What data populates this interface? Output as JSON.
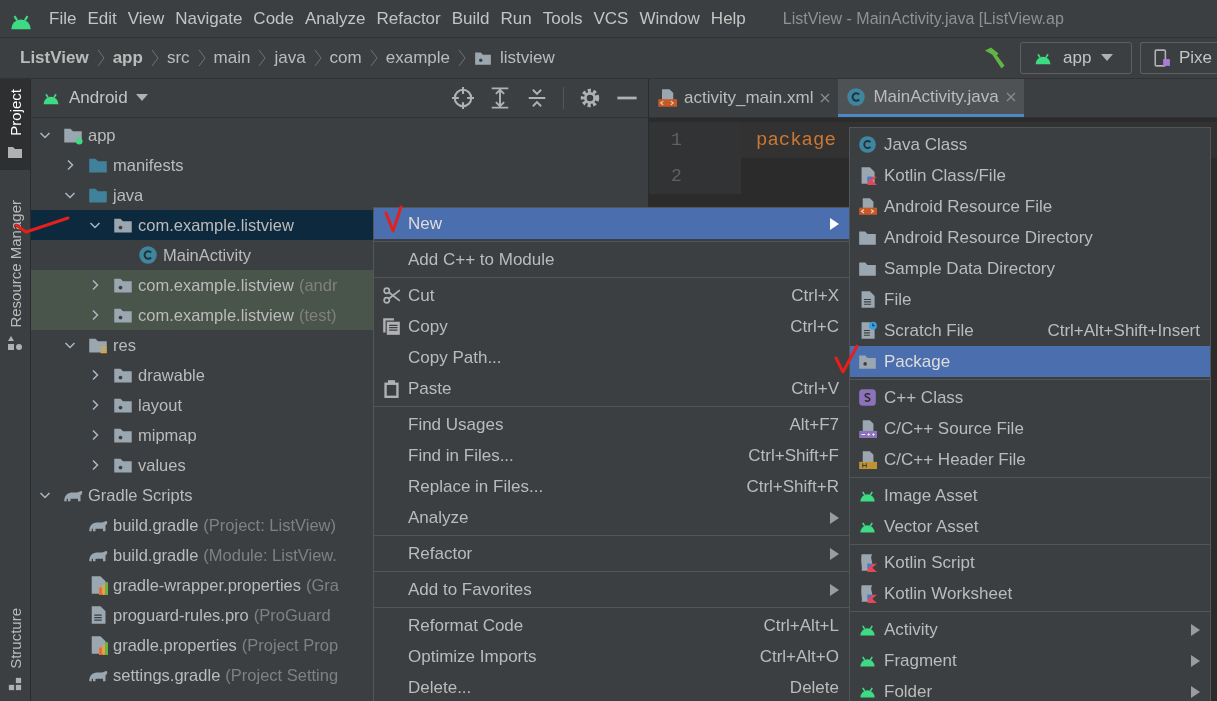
{
  "menubar": {
    "items": [
      "File",
      "Edit",
      "View",
      "Navigate",
      "Code",
      "Analyze",
      "Refactor",
      "Build",
      "Run",
      "Tools",
      "VCS",
      "Window",
      "Help"
    ],
    "title": "ListView - MainActivity.java [ListView.ap"
  },
  "breadcrumbs": [
    {
      "label": "ListView",
      "bold": true,
      "kind": "plain"
    },
    {
      "label": "app",
      "bold": true,
      "kind": "plain"
    },
    {
      "label": "src",
      "bold": false,
      "kind": "plain"
    },
    {
      "label": "main",
      "bold": false,
      "kind": "plain"
    },
    {
      "label": "java",
      "bold": false,
      "kind": "plain"
    },
    {
      "label": "com",
      "bold": false,
      "kind": "plain"
    },
    {
      "label": "example",
      "bold": false,
      "kind": "plain"
    },
    {
      "label": "listview",
      "bold": false,
      "kind": "package"
    }
  ],
  "run_config": {
    "label": "app"
  },
  "device": {
    "label": "Pixe"
  },
  "tool_stripe": {
    "top": [
      {
        "label": "Project",
        "selected": true
      },
      {
        "label": "Resource Manager",
        "selected": false
      }
    ],
    "bottom": [
      {
        "label": "Structure",
        "selected": false
      }
    ]
  },
  "project_panel": {
    "view": "Android",
    "tree": [
      {
        "label": "app",
        "kind": "module",
        "expanded": true,
        "selected": false,
        "tinted": false,
        "children": [
          {
            "label": "manifests",
            "kind": "folder",
            "expanded": false,
            "selected": false,
            "tinted": false
          },
          {
            "label": "java",
            "kind": "folder",
            "expanded": true,
            "selected": false,
            "tinted": false,
            "children": [
              {
                "label": "com.example.listview",
                "kind": "package",
                "expanded": true,
                "selected": true,
                "tinted": false,
                "children": [
                  {
                    "label": "MainActivity",
                    "kind": "class",
                    "selected": false,
                    "tinted": false
                  }
                ]
              },
              {
                "label": "com.example.listview",
                "note": "(andr",
                "kind": "package",
                "expanded": false,
                "selected": false,
                "tinted": true
              },
              {
                "label": "com.example.listview",
                "note": "(test)",
                "kind": "package",
                "expanded": false,
                "selected": false,
                "tinted": true
              }
            ]
          },
          {
            "label": "res",
            "kind": "res",
            "expanded": true,
            "selected": false,
            "tinted": false,
            "children": [
              {
                "label": "drawable",
                "kind": "package",
                "expanded": false,
                "selected": false,
                "tinted": false
              },
              {
                "label": "layout",
                "kind": "package",
                "expanded": false,
                "selected": false,
                "tinted": false
              },
              {
                "label": "mipmap",
                "kind": "package",
                "expanded": false,
                "selected": false,
                "tinted": false
              },
              {
                "label": "values",
                "kind": "package",
                "expanded": false,
                "selected": false,
                "tinted": false
              }
            ]
          }
        ]
      },
      {
        "label": "Gradle Scripts",
        "kind": "gradle",
        "expanded": true,
        "selected": false,
        "tinted": false,
        "children": [
          {
            "label": "build.gradle",
            "note": "(Project: ListView)",
            "kind": "gradle",
            "selected": false,
            "tinted": false
          },
          {
            "label": "build.gradle",
            "note": "(Module: ListView.",
            "kind": "gradle",
            "selected": false,
            "tinted": false
          },
          {
            "label": "gradle-wrapper.properties",
            "note": "(Gra",
            "kind": "properties",
            "selected": false,
            "tinted": false
          },
          {
            "label": "proguard-rules.pro",
            "note": "(ProGuard",
            "kind": "text",
            "selected": false,
            "tinted": false
          },
          {
            "label": "gradle.properties",
            "note": "(Project Prop",
            "kind": "properties",
            "selected": false,
            "tinted": false
          },
          {
            "label": "settings.gradle",
            "note": "(Project Setting",
            "kind": "gradle",
            "selected": false,
            "tinted": false
          }
        ]
      }
    ]
  },
  "editor": {
    "tabs": [
      {
        "label": "activity_main.xml",
        "kind": "xml",
        "selected": false
      },
      {
        "label": "MainActivity.java",
        "kind": "java",
        "selected": true
      }
    ],
    "lines": [
      {
        "number": "1",
        "code": "package",
        "current": true
      },
      {
        "number": "2",
        "current": false
      }
    ]
  },
  "context_menu": {
    "groups": [
      [
        {
          "label": "New",
          "submenu": true,
          "selected": true
        }
      ],
      [
        {
          "label": "Add C++ to Module",
          "submenu": false,
          "selected": false
        }
      ],
      [
        {
          "label": "Cut",
          "shortcut": "Ctrl+X",
          "kind": "cut",
          "submenu": false,
          "selected": false
        },
        {
          "label": "Copy",
          "shortcut": "Ctrl+C",
          "kind": "copy",
          "submenu": false,
          "selected": false
        },
        {
          "label": "Copy Path...",
          "submenu": false,
          "selected": false
        },
        {
          "label": "Paste",
          "shortcut": "Ctrl+V",
          "kind": "paste",
          "submenu": false,
          "selected": false
        }
      ],
      [
        {
          "label": "Find Usages",
          "shortcut": "Alt+F7",
          "submenu": false,
          "selected": false
        },
        {
          "label": "Find in Files...",
          "shortcut": "Ctrl+Shift+F",
          "submenu": false,
          "selected": false
        },
        {
          "label": "Replace in Files...",
          "shortcut": "Ctrl+Shift+R",
          "submenu": false,
          "selected": false
        },
        {
          "label": "Analyze",
          "submenu": true,
          "selected": false
        }
      ],
      [
        {
          "label": "Refactor",
          "submenu": true,
          "selected": false
        }
      ],
      [
        {
          "label": "Add to Favorites",
          "submenu": true,
          "selected": false
        }
      ],
      [
        {
          "label": "Reformat Code",
          "shortcut": "Ctrl+Alt+L",
          "submenu": false,
          "selected": false
        },
        {
          "label": "Optimize Imports",
          "shortcut": "Ctrl+Alt+O",
          "submenu": false,
          "selected": false
        },
        {
          "label": "Delete...",
          "shortcut": "Delete",
          "submenu": false,
          "selected": false
        }
      ]
    ]
  },
  "new_submenu": {
    "groups": [
      [
        {
          "label": "Java Class",
          "kind": "class",
          "submenu": false,
          "selected": false
        },
        {
          "label": "Kotlin Class/File",
          "kind": "kotlin",
          "submenu": false,
          "selected": false
        },
        {
          "label": "Android Resource File",
          "kind": "xml",
          "submenu": false,
          "selected": false
        },
        {
          "label": "Android Resource Directory",
          "kind": "dir",
          "submenu": false,
          "selected": false
        },
        {
          "label": "Sample Data Directory",
          "kind": "dir",
          "submenu": false,
          "selected": false
        },
        {
          "label": "File",
          "kind": "text",
          "submenu": false,
          "selected": false
        },
        {
          "label": "Scratch File",
          "shortcut": "Ctrl+Alt+Shift+Insert",
          "kind": "scratch",
          "submenu": false,
          "selected": false
        },
        {
          "label": "Package",
          "kind": "package",
          "submenu": false,
          "selected": true
        }
      ],
      [
        {
          "label": "C++ Class",
          "kind": "cppclass",
          "submenu": false,
          "selected": false
        },
        {
          "label": "C/C++ Source File",
          "kind": "csource",
          "submenu": false,
          "selected": false
        },
        {
          "label": "C/C++ Header File",
          "kind": "cheader",
          "submenu": false,
          "selected": false
        }
      ],
      [
        {
          "label": "Image Asset",
          "kind": "android",
          "submenu": false,
          "selected": false
        },
        {
          "label": "Vector Asset",
          "kind": "android",
          "submenu": false,
          "selected": false
        }
      ],
      [
        {
          "label": "Kotlin Script",
          "kind": "kscript",
          "submenu": false,
          "selected": false
        },
        {
          "label": "Kotlin Worksheet",
          "kind": "kscript",
          "submenu": false,
          "selected": false
        }
      ],
      [
        {
          "label": "Activity",
          "kind": "android",
          "submenu": true,
          "selected": false
        },
        {
          "label": "Fragment",
          "kind": "android",
          "submenu": true,
          "selected": false
        },
        {
          "label": "Folder",
          "kind": "android",
          "submenu": true,
          "selected": false
        }
      ]
    ]
  }
}
